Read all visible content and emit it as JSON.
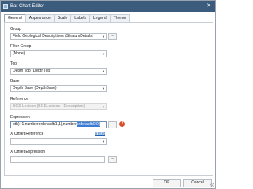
{
  "window": {
    "title": "Bar Chart Editor",
    "close_glyph": "✕"
  },
  "tabs": [
    "General",
    "Appearance",
    "Scale",
    "Labels",
    "Legend",
    "Theme"
  ],
  "fields": {
    "group": {
      "label": "Group",
      "value": "Field Geological Descriptions (StratumDetails)",
      "button": "..."
    },
    "filter_group": {
      "label": "Filter Group",
      "value": "(None)"
    },
    "top": {
      "label": "Top",
      "value": "Depth Top (DepthTop)"
    },
    "base": {
      "label": "Base",
      "value": "Depth Base (DepthBase)"
    },
    "reference": {
      "label": "Reference",
      "value": "BGS Lexicon (BGSLexicon - Description)"
    },
    "expression": {
      "label": "Expression",
      "value_pre": "pth)+1,numberordefault(1,1),number",
      "value_selected": "ordefault(0,0)",
      "button": "...",
      "error_glyph": "!"
    },
    "x_offset_reference": {
      "label": "X Offset Reference",
      "reset": "Reset",
      "value": ""
    },
    "x_offset_expression": {
      "label": "X Offset Expression",
      "value": "",
      "button": "..."
    }
  },
  "footer": {
    "ok": "OK",
    "cancel": "Cancel"
  },
  "icons": {
    "dropdown": "chevron-down-icon",
    "error": "error-icon",
    "app": "app-icon"
  },
  "colors": {
    "titlebar": "#3b5c7c",
    "error": "#d9512c",
    "link": "#1a5fb4"
  }
}
